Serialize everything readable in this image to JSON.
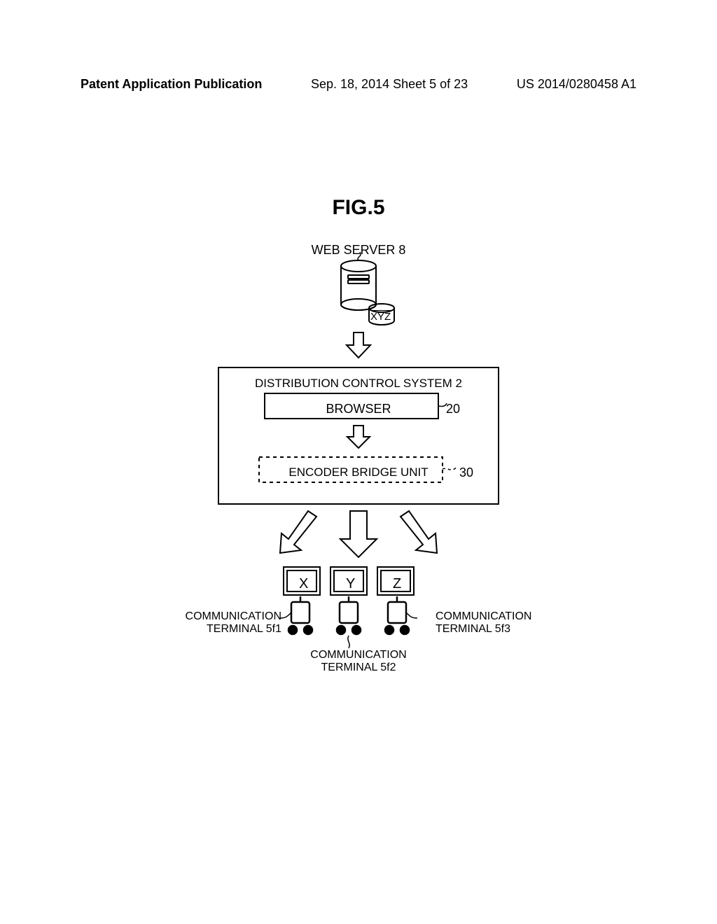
{
  "header": {
    "left": "Patent Application Publication",
    "mid": "Sep. 18, 2014  Sheet 5 of 23",
    "right": "US 2014/0280458 A1"
  },
  "figure": {
    "title": "FIG.5",
    "web_server_label": "WEB SERVER 8",
    "xyz": "XYZ",
    "dcs_title": "DISTRIBUTION CONTROL SYSTEM 2",
    "browser_label": "BROWSER",
    "browser_ref": "20",
    "encoder_label": "ENCODER BRIDGE UNIT",
    "encoder_ref": "30",
    "screens": {
      "x": "X",
      "y": "Y",
      "z": "Z"
    },
    "terminals": {
      "left": {
        "line1": "COMMUNICATION",
        "line2": "TERMINAL 5f1"
      },
      "mid": {
        "line1": "COMMUNICATION",
        "line2": "TERMINAL 5f2"
      },
      "right": {
        "line1": "COMMUNICATION",
        "line2": "TERMINAL 5f3"
      }
    }
  }
}
